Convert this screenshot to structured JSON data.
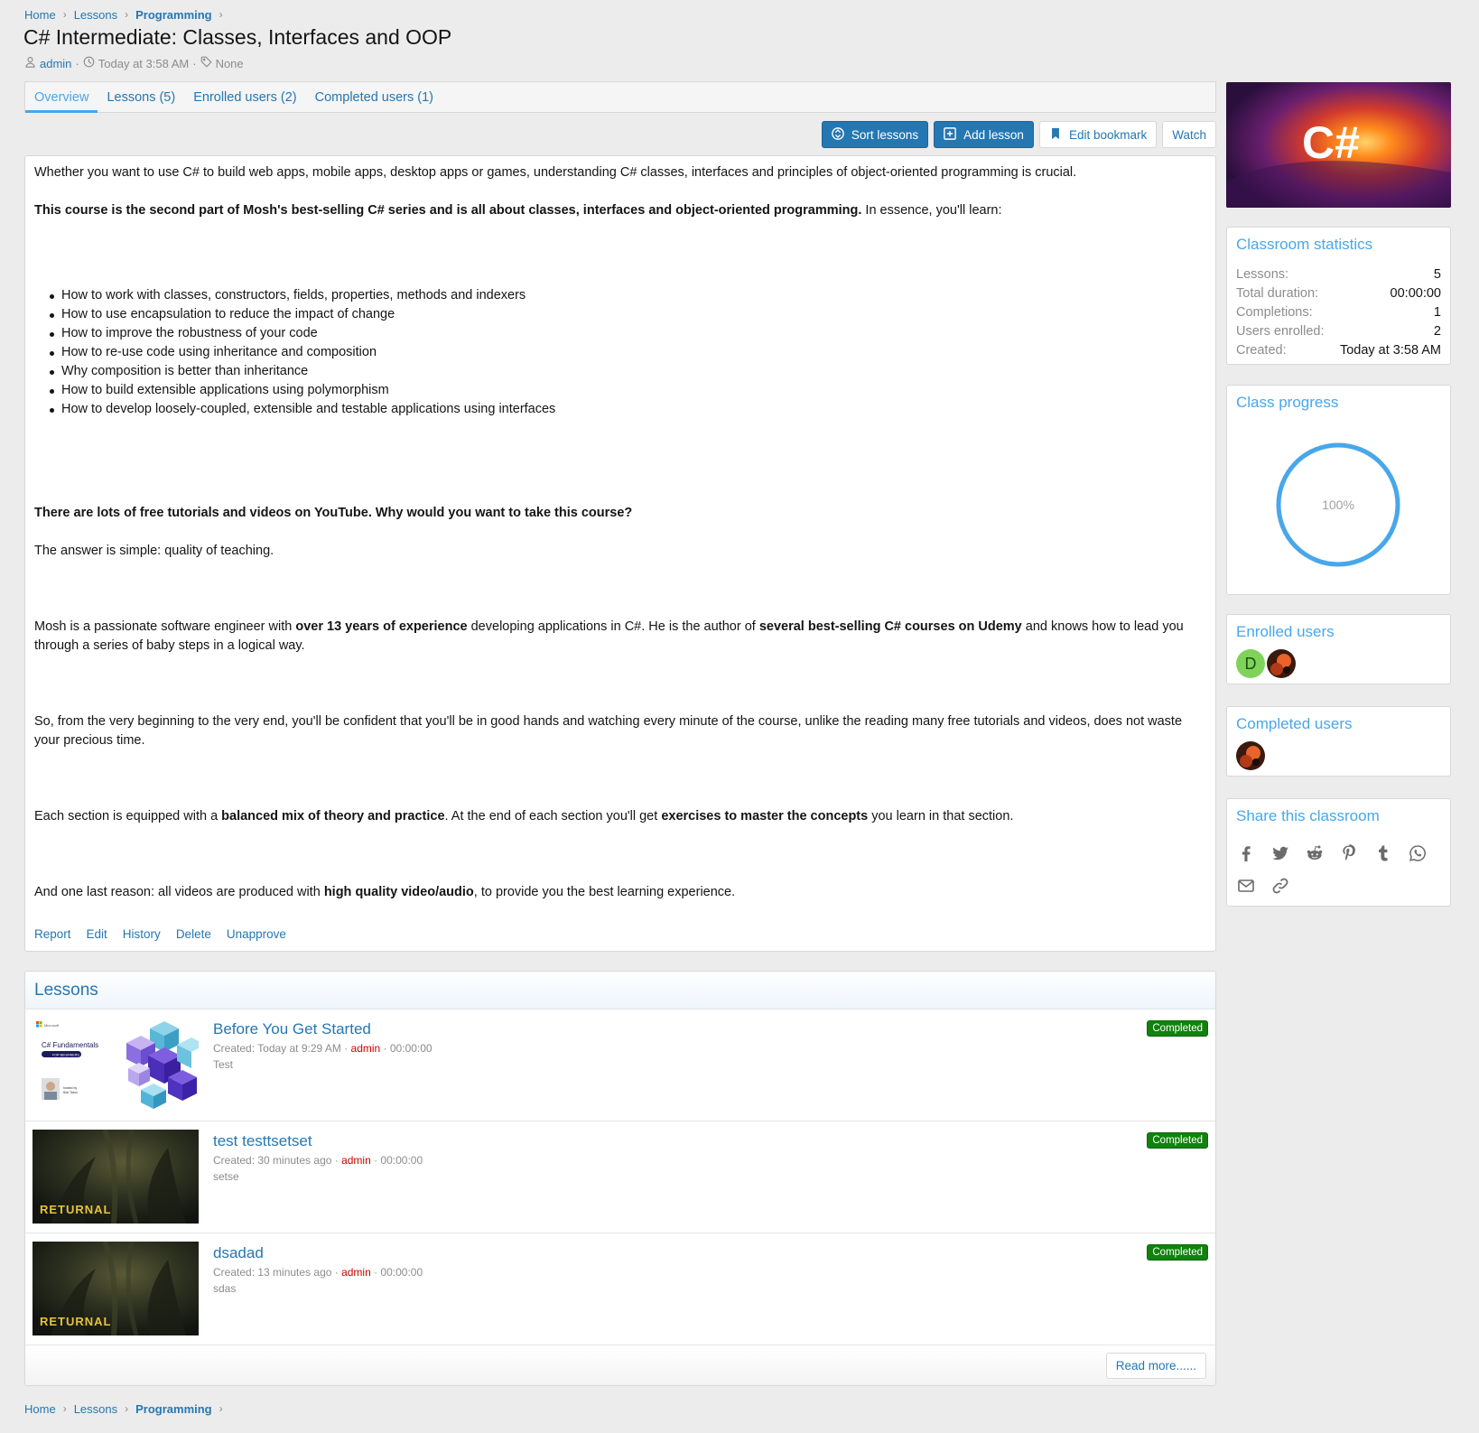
{
  "breadcrumb": {
    "items": [
      "Home",
      "Lessons",
      "Programming"
    ]
  },
  "page": {
    "title": "C# Intermediate: Classes, Interfaces and OOP",
    "author": "admin",
    "date": "Today at 3:58 AM",
    "tags": "None"
  },
  "tabs": [
    "Overview",
    "Lessons (5)",
    "Enrolled users (2)",
    "Completed users (1)"
  ],
  "actions": {
    "sort": "Sort lessons",
    "add": "Add lesson",
    "bookmark": "Edit bookmark",
    "watch": "Watch"
  },
  "content": {
    "p1": "Whether you want to use C# to build web apps, mobile apps, desktop apps or games, understanding C# classes, interfaces and principles of object-oriented programming is crucial.",
    "p2_bold": "This course is the second part of Mosh's best-selling C# series and is all about classes, interfaces and object-oriented programming.",
    "p2_rest": " In essence, you'll learn:",
    "bullets": [
      "How to work with classes, constructors, fields, properties, methods and indexers",
      "How to use encapsulation to reduce the impact of change",
      "How to improve the robustness of your code",
      "How to re-use code using inheritance and composition",
      "Why composition is better than inheritance",
      "How to build extensible applications using polymorphism",
      "How to develop loosely-coupled, extensible and testable applications using interfaces"
    ],
    "q_bold": "There are lots of free tutorials and videos on YouTube. Why would you want to take this course?",
    "answer": "The answer is simple: quality of teaching.",
    "mosh_1": "Mosh is a passionate software engineer with ",
    "mosh_b1": "over 13 years of experience",
    "mosh_2": " developing applications in C#. He is the author of ",
    "mosh_b2": "several best-selling C# courses on Udemy",
    "mosh_3": " and knows how to lead you through a series of baby steps in a logical way.",
    "so": "So, from the very beginning to the very end, you'll be confident that you'll be in good hands and watching every minute of the course, unlike the reading many free tutorials and videos, does not waste your precious time.",
    "each_1": "Each section is equipped with a ",
    "each_b1": "balanced mix of theory and practice",
    "each_2": ". At the end of each section you'll get ",
    "each_b2": "exercises to master the concepts",
    "each_3": " you learn in that section.",
    "last_1": "And one last reason: all videos are produced with ",
    "last_b1": "high quality video/audio",
    "last_2": ", to provide you the best learning experience."
  },
  "post_links": [
    "Report",
    "Edit",
    "History",
    "Delete",
    "Unapprove"
  ],
  "lessons": {
    "title": "Lessons",
    "items": [
      {
        "title": "Before You Get Started",
        "created": "Created: Today at 9:29 AM · ",
        "user": "admin",
        "duration": " · 00:00:00",
        "desc": "Test",
        "status": "Completed",
        "thumb_brand": "Microsoft",
        "thumb_title": "C# Fundamentals",
        "thumb_sub": "FOR BEGINNERS",
        "thumb_hosted1": "hosted by",
        "thumb_hosted2": "Bob Tabor"
      },
      {
        "title": "test testtsetset",
        "created": "Created: 30 minutes ago · ",
        "user": "admin",
        "duration": " · 00:00:00",
        "desc": "setse",
        "status": "Completed",
        "thumb_text": "RETURNAL"
      },
      {
        "title": "dsadad",
        "created": "Created: 13 minutes ago · ",
        "user": "admin",
        "duration": " · 00:00:00",
        "desc": "sdas",
        "status": "Completed",
        "thumb_text": "RETURNAL"
      }
    ],
    "read_more": "Read more......"
  },
  "sidebar": {
    "cover_text": "C#",
    "stats": {
      "title": "Classroom statistics",
      "rows": [
        {
          "k": "Lessons:",
          "v": "5"
        },
        {
          "k": "Total duration:",
          "v": "00:00:00"
        },
        {
          "k": "Completions:",
          "v": "1"
        },
        {
          "k": "Users enrolled:",
          "v": "2"
        },
        {
          "k": "Created:",
          "v": "Today at 3:58 AM"
        }
      ]
    },
    "progress": {
      "title": "Class progress",
      "label": "100%",
      "value": 1.0
    },
    "enrolled": {
      "title": "Enrolled users",
      "initial": "D"
    },
    "completed": {
      "title": "Completed users"
    },
    "share": {
      "title": "Share this classroom"
    }
  },
  "colors": {
    "link": "#2577b1",
    "accent": "#47a7eb",
    "completed_badge": "#12810e",
    "admin_user": "#d10000"
  }
}
